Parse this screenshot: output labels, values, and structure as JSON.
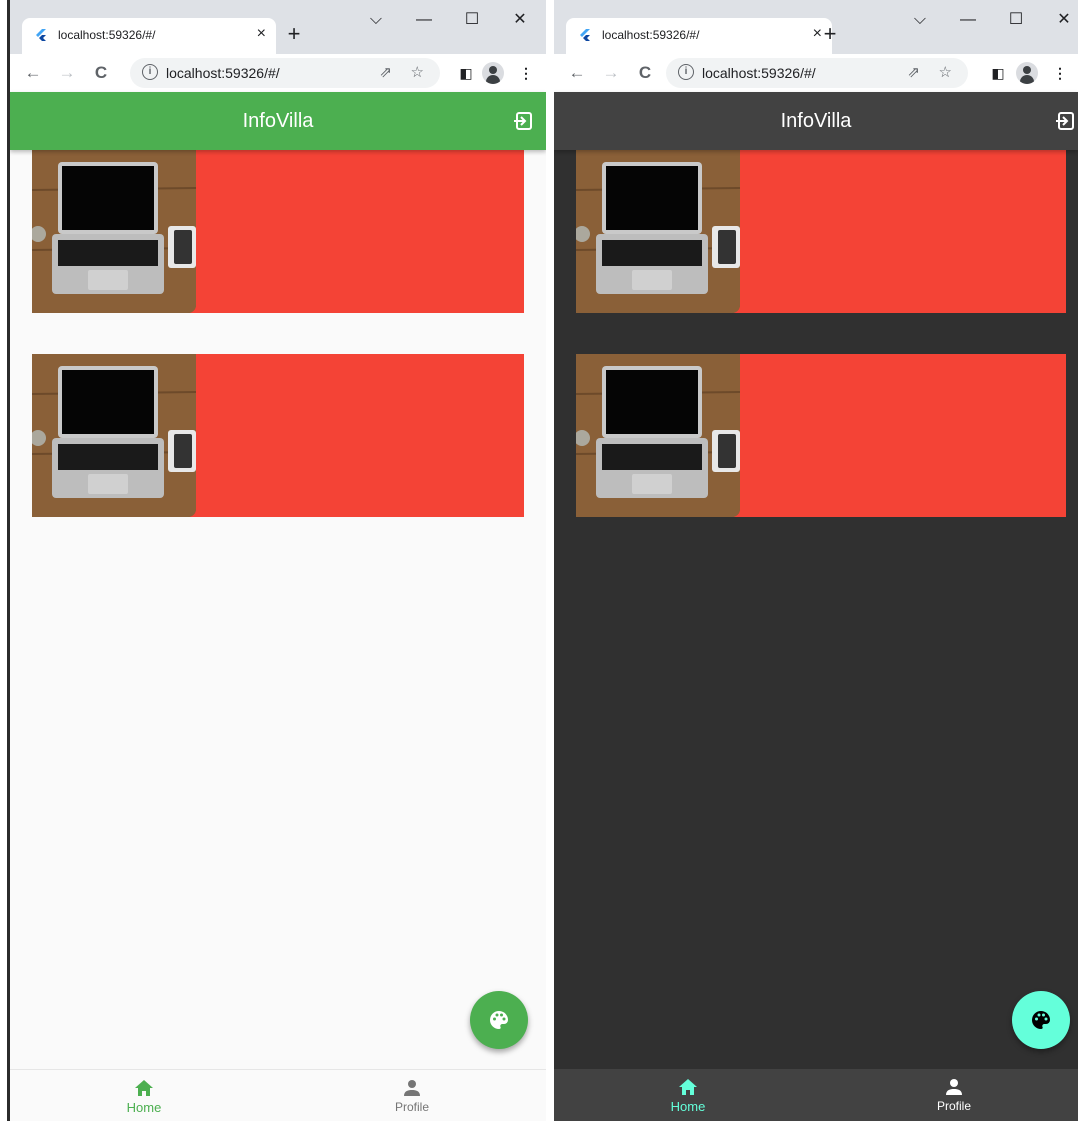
{
  "browser": {
    "tab_title": "localhost:59326/#/",
    "tab_close": "×",
    "new_tab": "+",
    "url": "localhost:59326/#/",
    "window_controls": {
      "dropdown": "⌵",
      "minimize": "—",
      "maximize": "☐",
      "close": "✕"
    },
    "nav": {
      "back": "←",
      "forward": "→",
      "reload": "C"
    },
    "icons": {
      "favicon": "flutter-icon",
      "info": "info-icon",
      "share": "share-icon",
      "bookmark": "star-icon",
      "sidepanel": "side-panel-icon",
      "profile": "profile-avatar-icon",
      "menu": "kebab-menu-icon"
    }
  },
  "app": {
    "title": "InfoVilla",
    "actions": {
      "logout_icon": "logout-icon",
      "theme_fab_icon": "palette-icon"
    },
    "cards": [
      {
        "image": "laptop-on-desk-photo"
      },
      {
        "image": "laptop-on-desk-photo"
      }
    ],
    "bottom_nav": [
      {
        "label": "Home",
        "icon": "home-icon",
        "selected": true
      },
      {
        "label": "Profile",
        "icon": "person-icon",
        "selected": false
      }
    ]
  },
  "themes": {
    "light": {
      "appbar": "#4caf50",
      "background": "#fafafa",
      "nav_background": "#fafafa",
      "accent": "#4caf50",
      "inactive": "#757575",
      "fab": "#4caf50",
      "fab_icon": "#ffffff"
    },
    "dark": {
      "appbar": "#424242",
      "background": "#303030",
      "nav_background": "#424242",
      "accent": "#64ffda",
      "inactive": "#ffffff",
      "fab": "#64ffda",
      "fab_icon": "#000000"
    }
  },
  "card_color": "#f44336"
}
